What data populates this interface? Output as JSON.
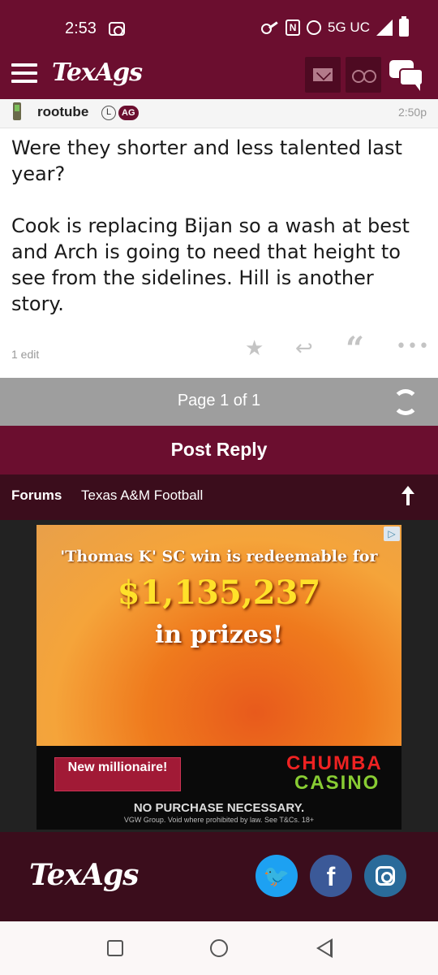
{
  "status_bar": {
    "time": "2:53",
    "network": "5G UC"
  },
  "header": {
    "logo": "TexAgs"
  },
  "post": {
    "username": "rootube",
    "badge_l": "L",
    "badge_ag": "AG",
    "time": "2:50p",
    "paragraphs": [
      "Were they shorter and less talented last year?",
      "Cook is replacing Bijan so a wash at best and Arch is going to need that height to see from the sidelines. Hill is another story."
    ],
    "edit_note": "1 edit"
  },
  "pager": {
    "label": "Page 1 of 1"
  },
  "post_reply": {
    "label": "Post Reply"
  },
  "breadcrumb": {
    "forums": "Forums",
    "subforum": "Texas A&M Football"
  },
  "ad": {
    "line1": "'Thomas K' SC win is redeemable for",
    "amount": "$1,135,237",
    "line3": "in prizes!",
    "badge": "New millionaire!",
    "brand_line1": "CHUMBA",
    "brand_line2": "CASINO",
    "legal": "NO PURCHASE NECESSARY.",
    "fine_print": "VGW Group. Void where prohibited by law. See T&Cs. 18+"
  },
  "footer": {
    "logo": "TexAgs",
    "twitter_glyph": "🐦",
    "facebook_glyph": "f"
  },
  "colors": {
    "maroon": "#6b0e2f",
    "dark_maroon": "#3b0d1c",
    "pager_gray": "#9e9e9e"
  }
}
